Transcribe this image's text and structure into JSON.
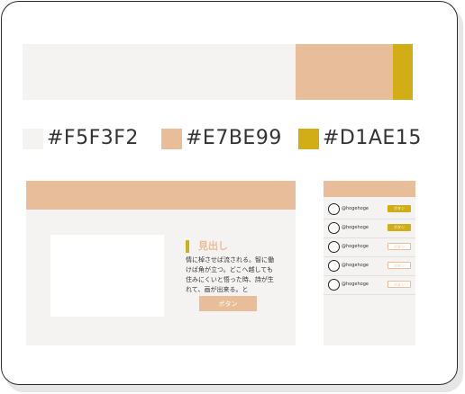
{
  "colors": {
    "base": "#F5F3F2",
    "main": "#E7BE99",
    "accent": "#D1AE15"
  },
  "swatches": [
    {
      "label": "#F5F3F2",
      "color": "#F5F3F2"
    },
    {
      "label": "#E7BE99",
      "color": "#E7BE99"
    },
    {
      "label": "#D1AE15",
      "color": "#D1AE15"
    }
  ],
  "mockup": {
    "heading": "見出し",
    "paragraph": "情に棹させば流される。智に働けば角が立つ。どこへ越しても住みにくいと悟った時、詩が生れて、画が出来る。と",
    "button_label": "ボタン"
  },
  "list": {
    "rows": [
      {
        "name": "@hogehoge",
        "button": "ボタン",
        "style": "filled"
      },
      {
        "name": "@hogehoge",
        "button": "ボタン",
        "style": "filled"
      },
      {
        "name": "@hogehoge",
        "button": "ボタン",
        "style": "outline"
      },
      {
        "name": "@hogehoge",
        "button": "ボタン",
        "style": "outline"
      },
      {
        "name": "@hogehoge",
        "button": "ボタン",
        "style": "outline"
      }
    ]
  }
}
